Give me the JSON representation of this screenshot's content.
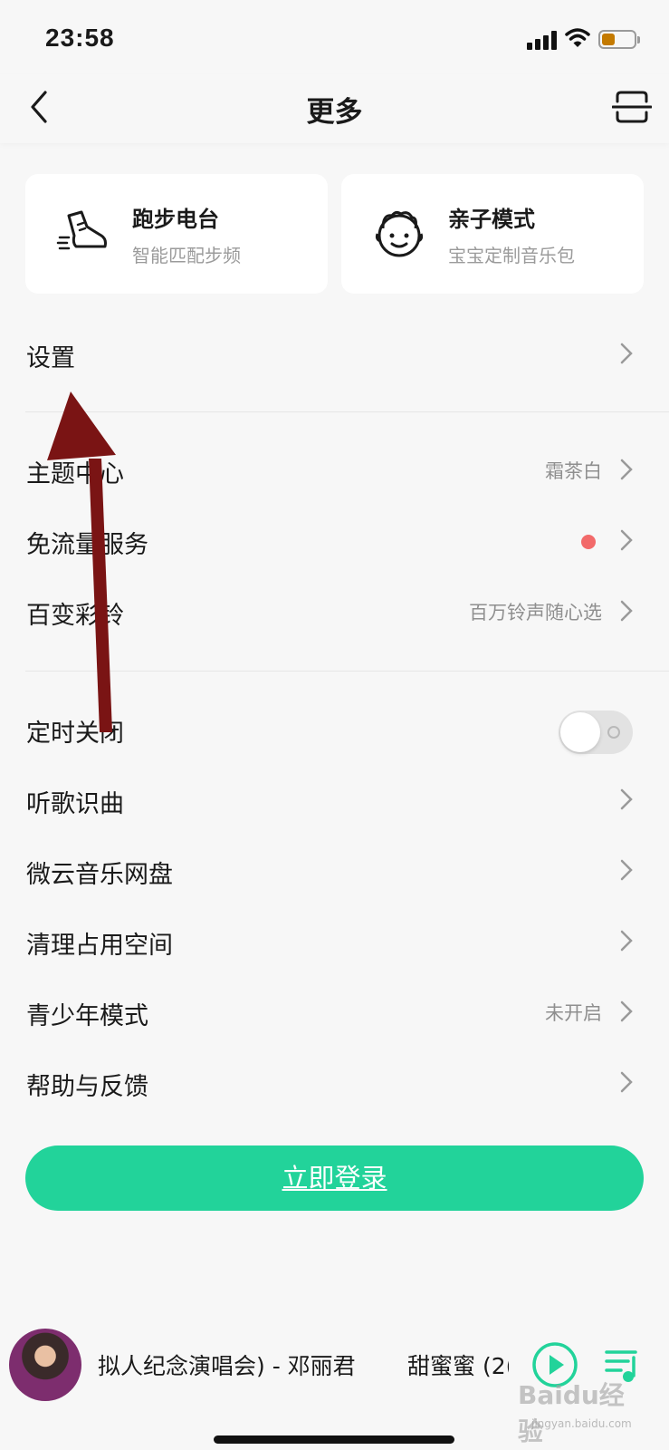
{
  "status_bar": {
    "time": "23:58"
  },
  "nav": {
    "title": "更多"
  },
  "cards": [
    {
      "title": "跑步电台",
      "subtitle": "智能匹配步频",
      "icon": "running-shoe-icon"
    },
    {
      "title": "亲子模式",
      "subtitle": "宝宝定制音乐包",
      "icon": "baby-face-icon"
    }
  ],
  "settings": {
    "label": "设置"
  },
  "group1": [
    {
      "label": "主题中心",
      "value": "霜茶白"
    },
    {
      "label": "免流量服务",
      "value": ""
    },
    {
      "label": "百变彩铃",
      "value": "百万铃声随心选"
    }
  ],
  "group2": [
    {
      "label": "定时关闭",
      "toggle": false
    },
    {
      "label": "听歌识曲"
    },
    {
      "label": "微云音乐网盘"
    },
    {
      "label": "清理占用空间"
    },
    {
      "label": "青少年模式",
      "value": "未开启"
    },
    {
      "label": "帮助与反馈"
    }
  ],
  "login": {
    "label": "立即登录"
  },
  "player": {
    "track": "拟人纪念演唱会) - 邓丽君",
    "next": "甜蜜蜜 (2("
  },
  "watermark": {
    "text": "Baidu经验",
    "sub": "jingyan.baidu.com"
  },
  "colors": {
    "accent": "#22d39a",
    "red_dot": "#f26a6a",
    "arrow": "#7a1414"
  }
}
